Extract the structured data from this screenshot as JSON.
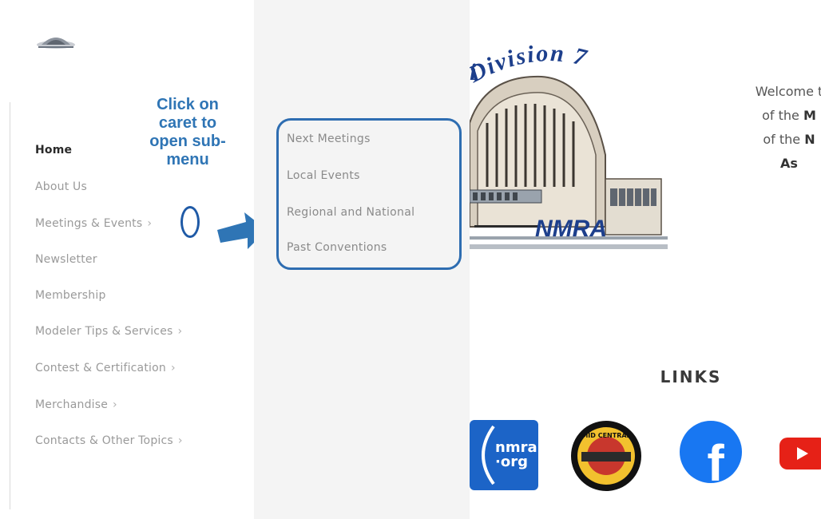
{
  "nav": {
    "items": [
      {
        "label": "Home",
        "active": true,
        "has_submenu": false
      },
      {
        "label": "About Us",
        "active": false,
        "has_submenu": false
      },
      {
        "label": "Meetings & Events",
        "active": false,
        "has_submenu": true
      },
      {
        "label": "Newsletter",
        "active": false,
        "has_submenu": false
      },
      {
        "label": "Membership",
        "active": false,
        "has_submenu": false
      },
      {
        "label": "Modeler Tips & Services",
        "active": false,
        "has_submenu": true
      },
      {
        "label": "Contest & Certification",
        "active": false,
        "has_submenu": true
      },
      {
        "label": "Merchandise",
        "active": false,
        "has_submenu": true
      },
      {
        "label": "Contacts & Other Topics",
        "active": false,
        "has_submenu": true
      }
    ],
    "caret_glyph": "›"
  },
  "callout": {
    "lines": [
      "Click on",
      "caret to",
      "open sub-",
      "menu"
    ],
    "color": "#2f75b5"
  },
  "submenu": {
    "items": [
      "Next Meetings",
      "Local Events",
      "Regional and National",
      "Past Conventions"
    ],
    "highlight_color": "#2e6db1"
  },
  "hero": {
    "arc_text": "Division 7",
    "nmra_text": "NMRA"
  },
  "welcome": {
    "line1": "Welcome t",
    "line2_pre": "of the ",
    "line2_bold": "M",
    "line3_pre": "of the ",
    "line3_bold": "N",
    "line4_bold": "As"
  },
  "links": {
    "heading": "LINKS",
    "icons": [
      {
        "name": "nmra-org-icon",
        "text_top": "nmra",
        "text_bottom": "·org"
      },
      {
        "name": "mid-central-region-icon",
        "text": "MID CENTRAL"
      },
      {
        "name": "facebook-icon",
        "text": "f"
      },
      {
        "name": "youtube-icon"
      }
    ]
  },
  "colors": {
    "brand_blue": "#1d3f8c",
    "facebook_blue": "#1877f2",
    "youtube_red": "#e62117"
  }
}
